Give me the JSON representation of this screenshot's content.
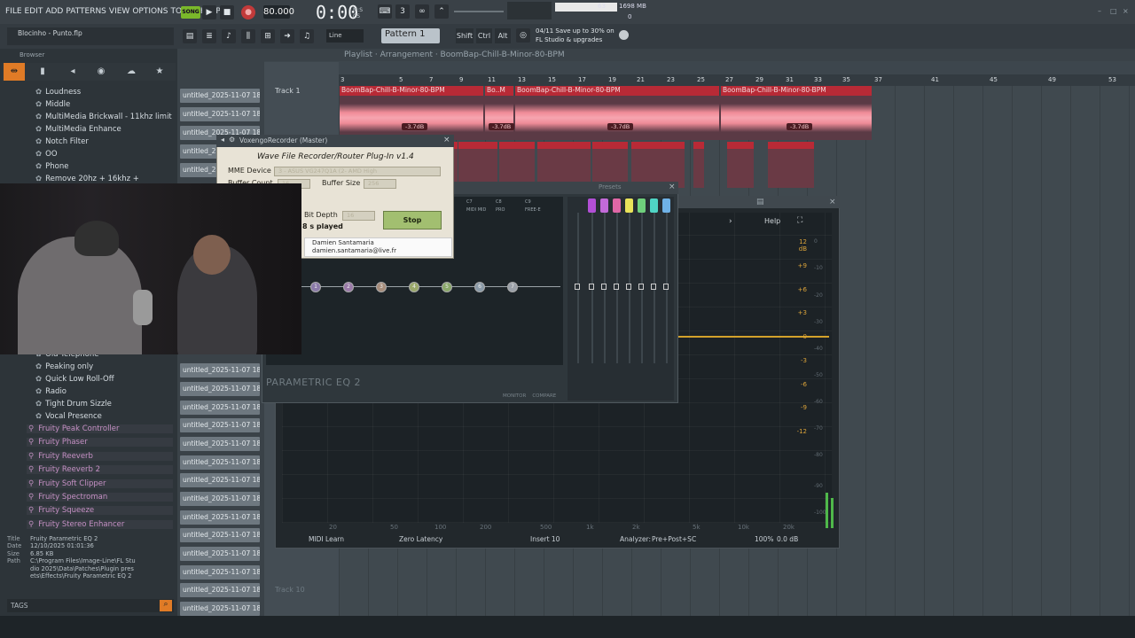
{
  "menu": [
    "FILE",
    "EDIT",
    "ADD",
    "PATTERNS",
    "VIEW",
    "OPTIONS",
    "TOOLS",
    "HELP"
  ],
  "transport": {
    "mode": "SONG",
    "bpm": "80.000",
    "time": "0:00",
    "time_unit_top": "M:S",
    "time_unit_bottom": "CS",
    "cpu": "63",
    "memory": "1698 MB",
    "polyphony": "0"
  },
  "toolbar": {
    "snap": "Line",
    "pattern": "Pattern 1",
    "shift": "Shift",
    "ctrl": "Ctrl",
    "alt": "Alt",
    "news_line1": "04/11  Save up to 30% on",
    "news_line2": "FL Studio & upgrades"
  },
  "browser": {
    "file": "Blocinho - Punto.flp",
    "title": "Browser",
    "presets": [
      "Loudness",
      "Middle",
      "MultiMedia Brickwall - 11khz limit",
      "MultiMedia Enhance",
      "Notch Filter",
      "OO",
      "Phone",
      "Remove 20hz + 16khz +",
      "Old Telephone",
      "Peaking only",
      "Quick Low Roll-Off",
      "Radio",
      "Tight Drum Sizzle",
      "Vocal Presence"
    ],
    "plugins": [
      "Fruity Peak Controller",
      "Fruity Phaser",
      "Fruity Reeverb",
      "Fruity Reeverb 2",
      "Fruity Soft Clipper",
      "Fruity Spectroman",
      "Fruity Squeeze",
      "Fruity Stereo Enhancer"
    ],
    "info": {
      "title_label": "Title",
      "title": "Fruity Parametric EQ 2",
      "date_label": "Date",
      "date": "12/10/2025 01:01:36",
      "size_label": "Size",
      "size": "6.85 KB",
      "path_label": "Path",
      "path": "C:\\Program Files\\Image-Line\\FL Studio 2025\\Data\\Patches\\Plugin presets\\Effects\\Fruity Parametric EQ 2"
    },
    "tags": "TAGS"
  },
  "picker": {
    "items": [
      "untitled_2025-11-07 18-...",
      "untitled_2025-11-07 18-...",
      "untitled_2025-11-07 18-...",
      "untitled_2025-11-07 18-...",
      "untitled_2025-11-07 18-...",
      "untitled_2025-11-07 18-...",
      "untitled_2025-11-07 18-...",
      "untitled_2025-11-07 18-...",
      "untitled_2025-11-07 18-...",
      "untitled_2025-11-07 18-...",
      "untitled_2025-11-07 18-...",
      "untitled_2025-11-07 18-...",
      "untitled_2025-11-07 18-...",
      "untitled_2025-11-07 18-...",
      "untitled_2025-11-07 18-...",
      "untitled_2025-11-07 18-..."
    ]
  },
  "playlist": {
    "breadcrumb": "Playlist · Arrangement · BoomBap-Chill-B-Minor-80-BPM",
    "track1": "Track 1",
    "track10": "Track 10",
    "ruler": [
      "3",
      "5",
      "7",
      "9",
      "11",
      "13",
      "15",
      "17",
      "19",
      "21",
      "23",
      "25",
      "27",
      "29",
      "31",
      "33",
      "35",
      "37",
      "41",
      "45",
      "49",
      "53"
    ],
    "clips": [
      "BoomBap-Chill-B-Minor-80-BPM",
      "Bo..M",
      "BoomBap-Chill-B-Minor-80-BPM",
      "BoomBap-Chill-B-Minor-80-BPM"
    ],
    "db": [
      "-3.7dB",
      "-3.7dB",
      "-3.7dB",
      "-3.7dB"
    ]
  },
  "voxengo": {
    "window_title": "VoxengoRecorder (Master)",
    "title": "Wave File Recorder/Router Plug-In v1.4",
    "mme_label": "MME Device",
    "mme_value": "3 - ASUS VG247Q1A (2- AMD High",
    "buffer_count_label": "Buffer Count",
    "buffer_count": "16",
    "buffer_size_label": "Buffer Size",
    "buffer_size": "256",
    "bit_depth_label": "Bit Depth",
    "bit_depth": "16",
    "stop": "Stop",
    "played": "8 s played",
    "credit_name": "Damien Santamaria",
    "credit_email": "damien.santamaria@live.fr"
  },
  "peq2": {
    "presets": "Presets",
    "logo": "PARAMETRIC EQ 2",
    "monitor": "MONITOR",
    "compare": "COMPARE",
    "node_labels": [
      "1",
      "2",
      "3",
      "4",
      "5",
      "6",
      "7"
    ],
    "tabs": [
      "C7",
      "C8",
      "C9",
      "MIDI MID",
      "PRO",
      "FREE-E"
    ]
  },
  "eq": {
    "help": "Help",
    "db_left": [
      "12 dB",
      "+9",
      "+6",
      "+3",
      "0",
      "-3",
      "-6",
      "-9",
      "-12"
    ],
    "db_right": [
      "0",
      "-10",
      "-20",
      "-30",
      "-40",
      "-50",
      "-60",
      "-70",
      "-80",
      "-90",
      "-100"
    ],
    "freqs": [
      "20",
      "50",
      "100",
      "200",
      "500",
      "1k",
      "2k",
      "5k",
      "10k",
      "20k"
    ],
    "midi_learn": "MIDI Learn",
    "latency": "Zero Latency",
    "insert": "Insert 10",
    "analyzer_label": "Analyzer:",
    "analyzer": "Pre+Post+SC",
    "zoom": "100%",
    "gain": "0.0 dB"
  },
  "colors": {
    "clip": "#b82a36",
    "wave": "#f29aa5",
    "eq_curve": "#d3a22b",
    "song": "#7ab82a"
  }
}
